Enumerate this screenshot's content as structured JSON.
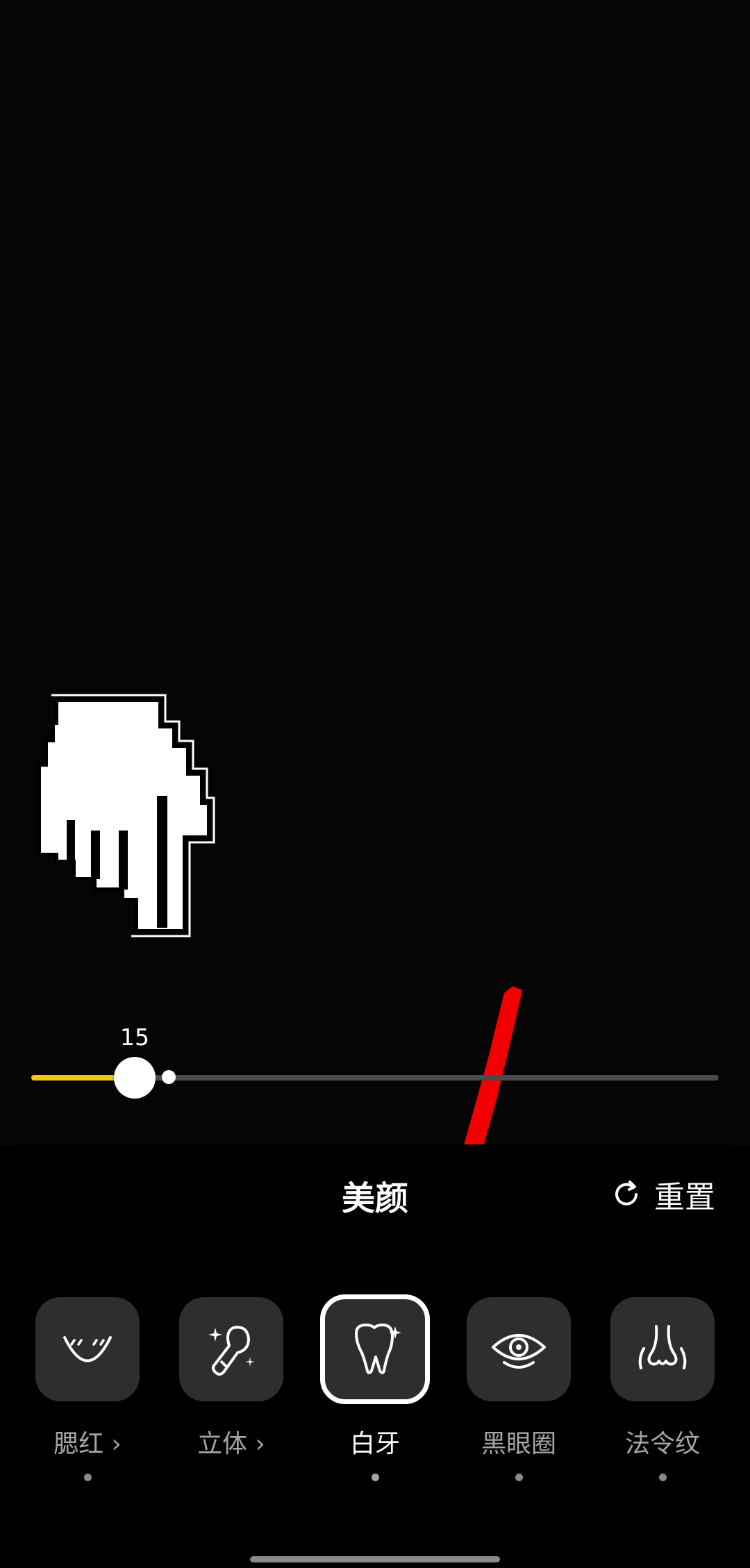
{
  "slider": {
    "value": 15,
    "value_label": "15",
    "max": 100,
    "default_value": 20,
    "fill_color": "#f5c21b"
  },
  "panel": {
    "title": "美颜",
    "reset_label": "重置",
    "reset_icon": "refresh-icon"
  },
  "items": [
    {
      "label": "腮红 ›",
      "icon": "blush-face-icon",
      "selected": false
    },
    {
      "label": "立体 ›",
      "icon": "contour-brush-icon",
      "selected": false
    },
    {
      "label": "白牙",
      "icon": "tooth-sparkle-icon",
      "selected": true
    },
    {
      "label": "黑眼圈",
      "icon": "eye-icon",
      "selected": false
    },
    {
      "label": "法令纹",
      "icon": "nose-lines-icon",
      "selected": false
    }
  ]
}
